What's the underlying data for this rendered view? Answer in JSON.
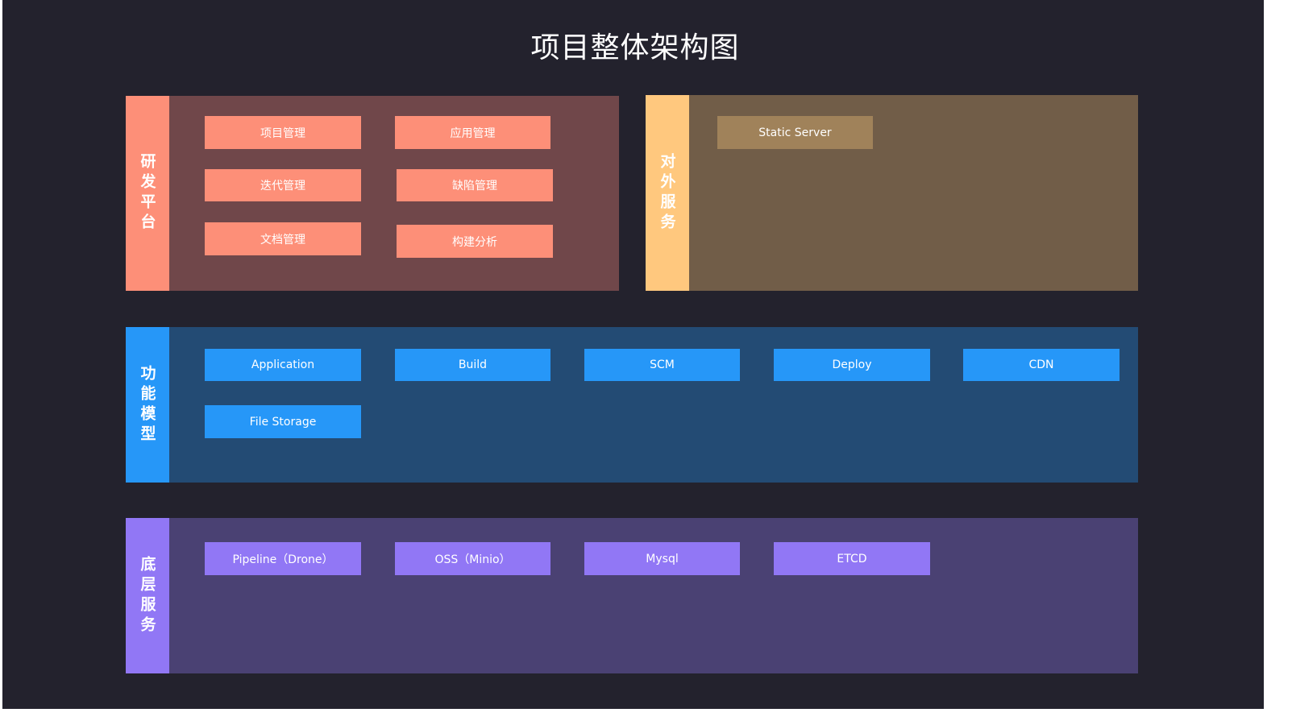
{
  "title": "项目整体架构图",
  "colors": {
    "background": "#23222d",
    "platform_panel": "#70474a",
    "platform_accent": "#fd8f78",
    "external_panel": "#715d48",
    "external_accent": "#ffc87e",
    "external_box": "#a0825a",
    "model_panel": "#234b74",
    "model_accent": "#2697f8",
    "infra_panel": "#4a4173",
    "infra_accent": "#9177f5"
  },
  "sections": {
    "platform": {
      "label": "研发平台",
      "items": [
        "项目管理",
        "应用管理",
        "迭代管理",
        "缺陷管理",
        "文档管理",
        "构建分析"
      ]
    },
    "external": {
      "label": "对外服务",
      "items": [
        "Static Server"
      ]
    },
    "model": {
      "label": "功能模型",
      "items": [
        "Application",
        "Build",
        "SCM",
        "Deploy",
        "CDN",
        "File Storage"
      ]
    },
    "infra": {
      "label": "底层服务",
      "items": [
        "Pipeline（Drone）",
        "OSS（Minio）",
        "Mysql",
        "ETCD"
      ]
    }
  }
}
